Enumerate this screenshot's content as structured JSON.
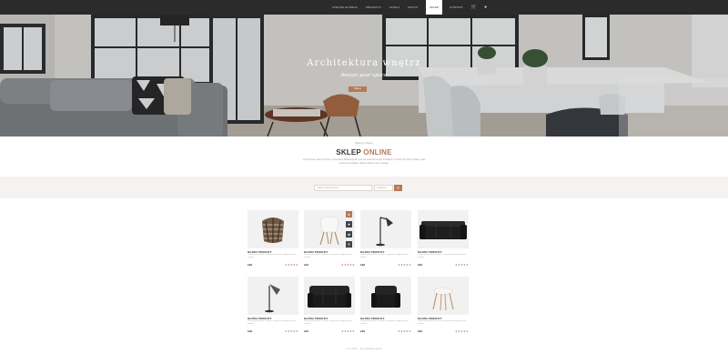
{
  "nav": {
    "items": [
      "Strona główna",
      "Produkty",
      "Dodaj",
      "Konto",
      "Sklep",
      "Kontakt"
    ],
    "active_index": 4,
    "icons": [
      "cart-icon",
      "user-icon"
    ]
  },
  "hero": {
    "title": "Architektura wnętrz",
    "subtitle": "design your space",
    "button": "Więcej"
  },
  "section": {
    "small": "Witamy w sklepie",
    "title_main": "SKLEP",
    "title_accent": "ONLINE",
    "description": "Lorem ipsum dolor sit amet, consectetur adipiscing elit, sed do eiusmod tempor incididunt. Ut enim ad minim veniam, quis nostrud exercitation ullamco laboris nisi ut aliquip."
  },
  "search": {
    "placeholder": "Wpisz szukaną frazę",
    "category": "Kategoria",
    "button_icon": "search-icon"
  },
  "products": [
    {
      "name": "NAZWA PRODUKT",
      "desc": "Lorem ipsum dolor sit amet, consectetur adipiscing elit sed do",
      "price": "£98",
      "rating": 5,
      "kind": "basket"
    },
    {
      "name": "NAZWA PRODUKT",
      "desc": "Lorem ipsum dolor sit amet, consectetur adipiscing elit sed do",
      "price": "£92",
      "rating": 5,
      "kind": "chair"
    },
    {
      "name": "NAZWA PRODUKT",
      "desc": "Lorem ipsum dolor sit amet, consectetur adipiscing elit sed do",
      "price": "£98",
      "rating": 5,
      "kind": "lamp"
    },
    {
      "name": "NAZWA PRODUKT",
      "desc": "Lorem ipsum dolor sit amet, consectetur adipiscing elit sed do",
      "price": "£89",
      "rating": 5,
      "kind": "sofa"
    },
    {
      "name": "NAZWA PRODUKT",
      "desc": "Lorem ipsum dolor sit amet, consectetur adipiscing elit sed do",
      "price": "£98",
      "rating": 5,
      "kind": "lamp"
    },
    {
      "name": "NAZWA PRODUKT",
      "desc": "Lorem ipsum dolor sit amet, consectetur adipiscing elit sed do",
      "price": "£92",
      "rating": 5,
      "kind": "sofa2"
    },
    {
      "name": "NAZWA PRODUKT",
      "desc": "Lorem ipsum dolor sit amet, consectetur adipiscing elit sed do",
      "price": "£98",
      "rating": 5,
      "kind": "armchair"
    },
    {
      "name": "NAZWA PRODUKT",
      "desc": "Lorem ipsum dolor sit amet, consectetur adipiscing elit sed do",
      "price": "£89",
      "rating": 5,
      "kind": "stool"
    }
  ],
  "hover_tools": [
    "cart-icon",
    "heart-icon",
    "compare-icon",
    "zoom-icon"
  ],
  "pagination": "« 1 2 3 4 5 … 10 »   Następna strona",
  "colors": {
    "accent": "#b47a55",
    "nav_bg": "#2b2b2b"
  }
}
